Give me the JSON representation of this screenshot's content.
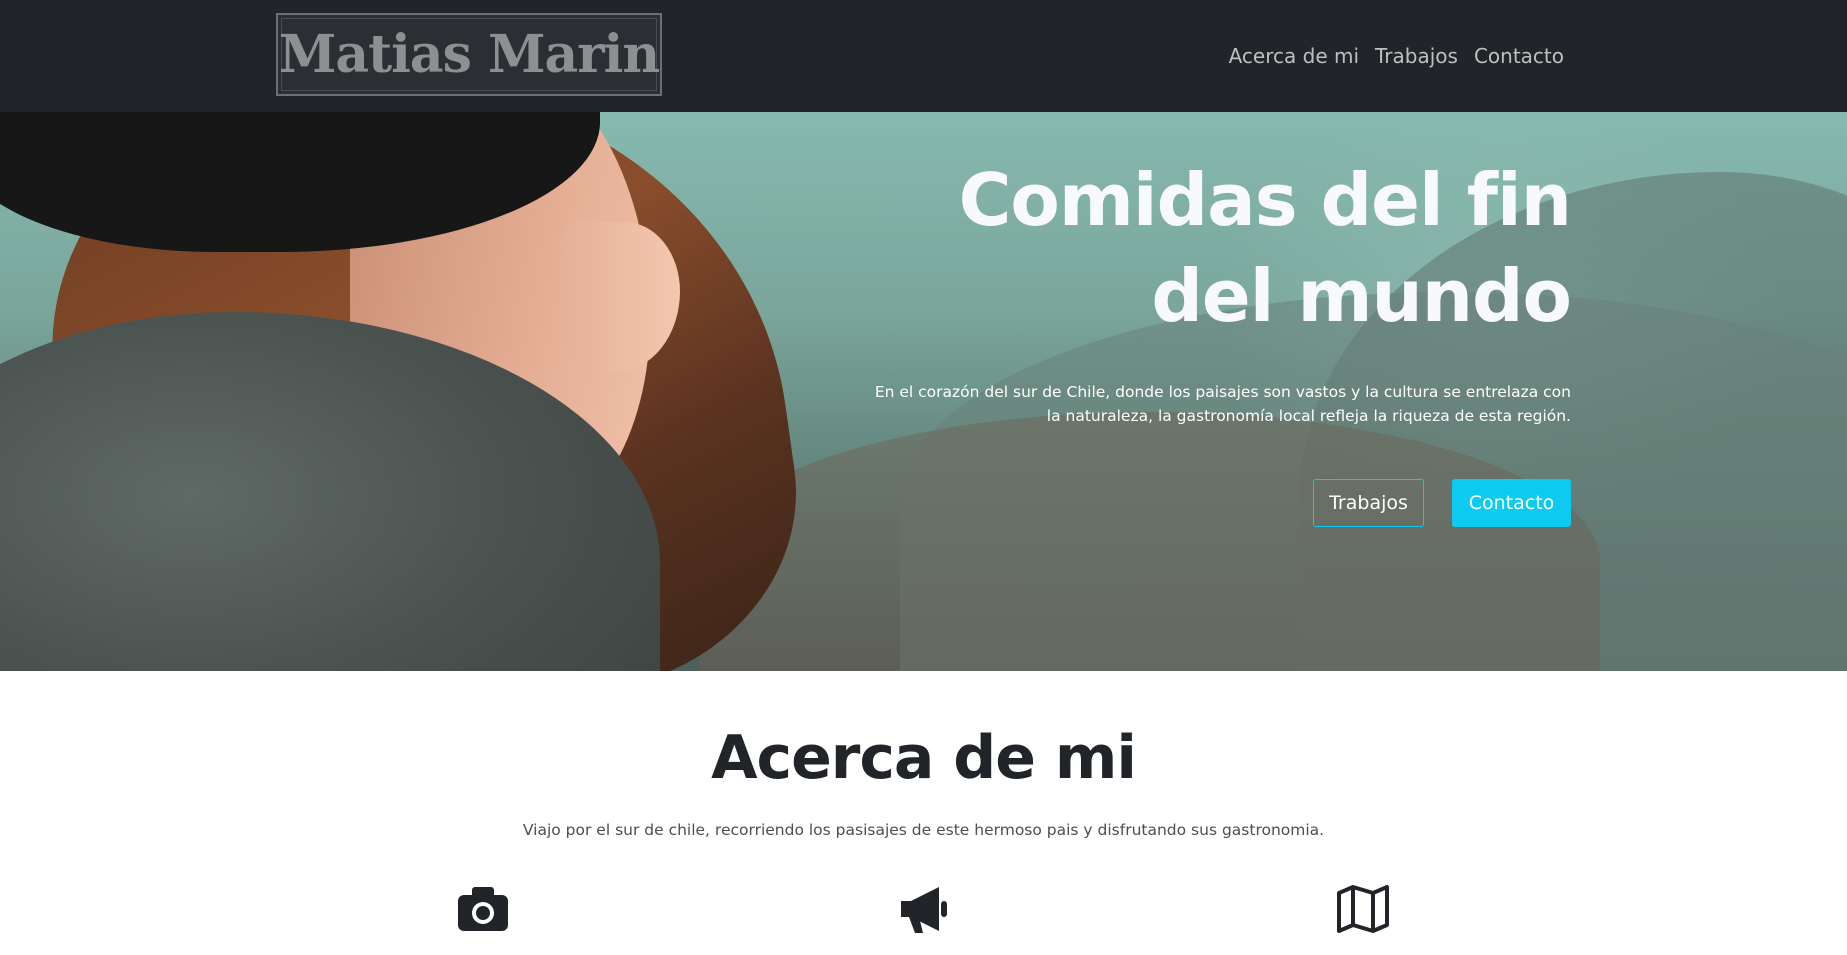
{
  "brand": {
    "name": "Matias Marin"
  },
  "nav": {
    "items": [
      {
        "label": "Acerca de mi"
      },
      {
        "label": "Trabajos"
      },
      {
        "label": "Contacto"
      }
    ]
  },
  "hero": {
    "title_line1": "Comidas del fin",
    "title_line2": "del mundo",
    "lead": "En el corazón del sur de Chile, donde los paisajes son vastos y la cultura se entrelaza con la naturaleza, la gastronomía local refleja la riqueza de esta región.",
    "buttons": {
      "primary": "Trabajos",
      "secondary": "Contacto"
    }
  },
  "about": {
    "title": "Acerca de mi",
    "text": "Viajo por el sur de chile, recorriendo los pasisajes de este hermoso pais y disfrutando sus gastronomia.",
    "icons": [
      "camera-icon",
      "megaphone-icon",
      "map-icon"
    ]
  },
  "colors": {
    "navbar_bg": "#212529",
    "accent": "#0dcaf0",
    "text_dark": "#212529"
  }
}
